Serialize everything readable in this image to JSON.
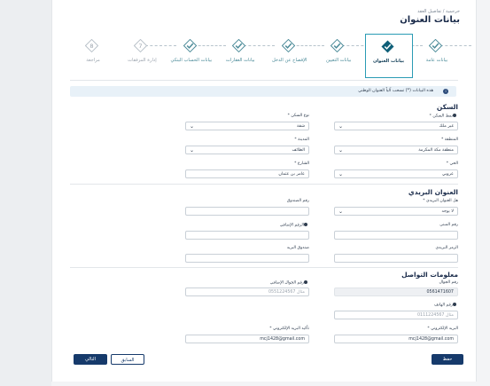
{
  "breadcrumb": "خرجمية / تفاصيل العقد",
  "page_title": "بيانات العنوان",
  "steps": [
    {
      "label": "بيانات عامة",
      "state": "done"
    },
    {
      "label": "بيانات العنوان",
      "state": "active"
    },
    {
      "label": "بيانات التعيين",
      "state": "done"
    },
    {
      "label": "الإفصاح عن الدخل",
      "state": "done"
    },
    {
      "label": "بيانات العقارات",
      "state": "done"
    },
    {
      "label": "بيانات الحساب البنكي",
      "state": "done"
    },
    {
      "label": "إدارة المرفقات",
      "state": "pending",
      "number": "7"
    },
    {
      "label": "مراجعة",
      "state": "pending",
      "number": "8"
    }
  ],
  "info_bar": {
    "text": "هذه البيانات (*) تسحب آلياً العنوان الوطني",
    "icon": "info-icon"
  },
  "residence": {
    "title": "السكن",
    "residence_type": {
      "label": "نمط السكن *",
      "value": "غير ملك"
    },
    "housing_type": {
      "label": "نوع السكن *",
      "value": "شقة"
    },
    "region": {
      "label": "المنطقة *",
      "value": "منطقة مكة المكرمة"
    },
    "city": {
      "label": "المدينة *",
      "value": "الطائف"
    },
    "district": {
      "label": "الحي *",
      "value": "عروبي"
    },
    "street": {
      "label": "الشارع *",
      "value": "عامر بن عثمان"
    }
  },
  "postal": {
    "title": "العنوان البريدي",
    "has_address": {
      "label": "هل العنوان البريدي *",
      "value": "لا يوجد"
    },
    "box_number": {
      "label": "رقم الصندوق",
      "value": ""
    },
    "building_number": {
      "label": "رقم المبنى",
      "value": ""
    },
    "extra_number": {
      "label": "الرقم الإضافي",
      "value": ""
    },
    "postal_code": {
      "label": "الرمز البريدي",
      "value": ""
    },
    "mailbox": {
      "label": "صندوق البريد",
      "value": ""
    }
  },
  "contact": {
    "title": "معلومات التواصل",
    "phone": {
      "label": "رقم الجوال",
      "value": "0561471607"
    },
    "alt_phone": {
      "label": "رقم الجوال الإضافي",
      "placeholder": "مثال 0551224567"
    },
    "landline": {
      "label": "رقم الهاتف",
      "placeholder": "مثال 0111224567"
    },
    "email": {
      "label": "البريد الإلكتروني *",
      "value": "mcj1428@gmail.com"
    },
    "email_confirm": {
      "label": "تأكيد البريد الإلكتروني *",
      "value": "mcj1428@gmail.com"
    }
  },
  "buttons": {
    "save": "حفظ",
    "previous": "السابق",
    "next": "التالي"
  },
  "colors": {
    "primary": "#163a6b",
    "accent": "#2a9bb4",
    "step_done": "#4a8a98"
  }
}
